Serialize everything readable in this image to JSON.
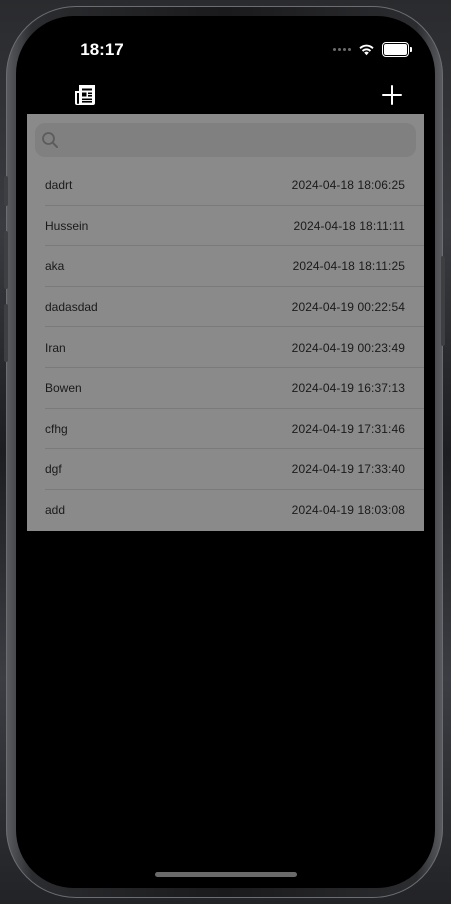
{
  "status_bar": {
    "time": "18:17"
  },
  "nav": {
    "left_icon": "newspaper-icon",
    "right_icon": "plus-icon"
  },
  "search": {
    "icon": "search-icon",
    "value": "",
    "placeholder": ""
  },
  "list": {
    "items": [
      {
        "name": "dadrt",
        "date": "2024-04-18 18:06:25"
      },
      {
        "name": "Hussein",
        "date": "2024-04-18 18:11:11"
      },
      {
        "name": "aka",
        "date": "2024-04-18 18:11:25"
      },
      {
        "name": "dadasdad",
        "date": "2024-04-19 00:22:54"
      },
      {
        "name": "Iran",
        "date": "2024-04-19 00:23:49"
      },
      {
        "name": "Bowen",
        "date": "2024-04-19 16:37:13"
      },
      {
        "name": "cfhg",
        "date": "2024-04-19 17:31:46"
      },
      {
        "name": "dgf",
        "date": "2024-04-19 17:33:40"
      },
      {
        "name": "add",
        "date": "2024-04-19 18:03:08"
      }
    ]
  },
  "colors": {
    "screen_bg": "#000000",
    "panel_bg": "#8a8a8a",
    "text": "#1a1a1a",
    "status_text": "#ffffff"
  }
}
